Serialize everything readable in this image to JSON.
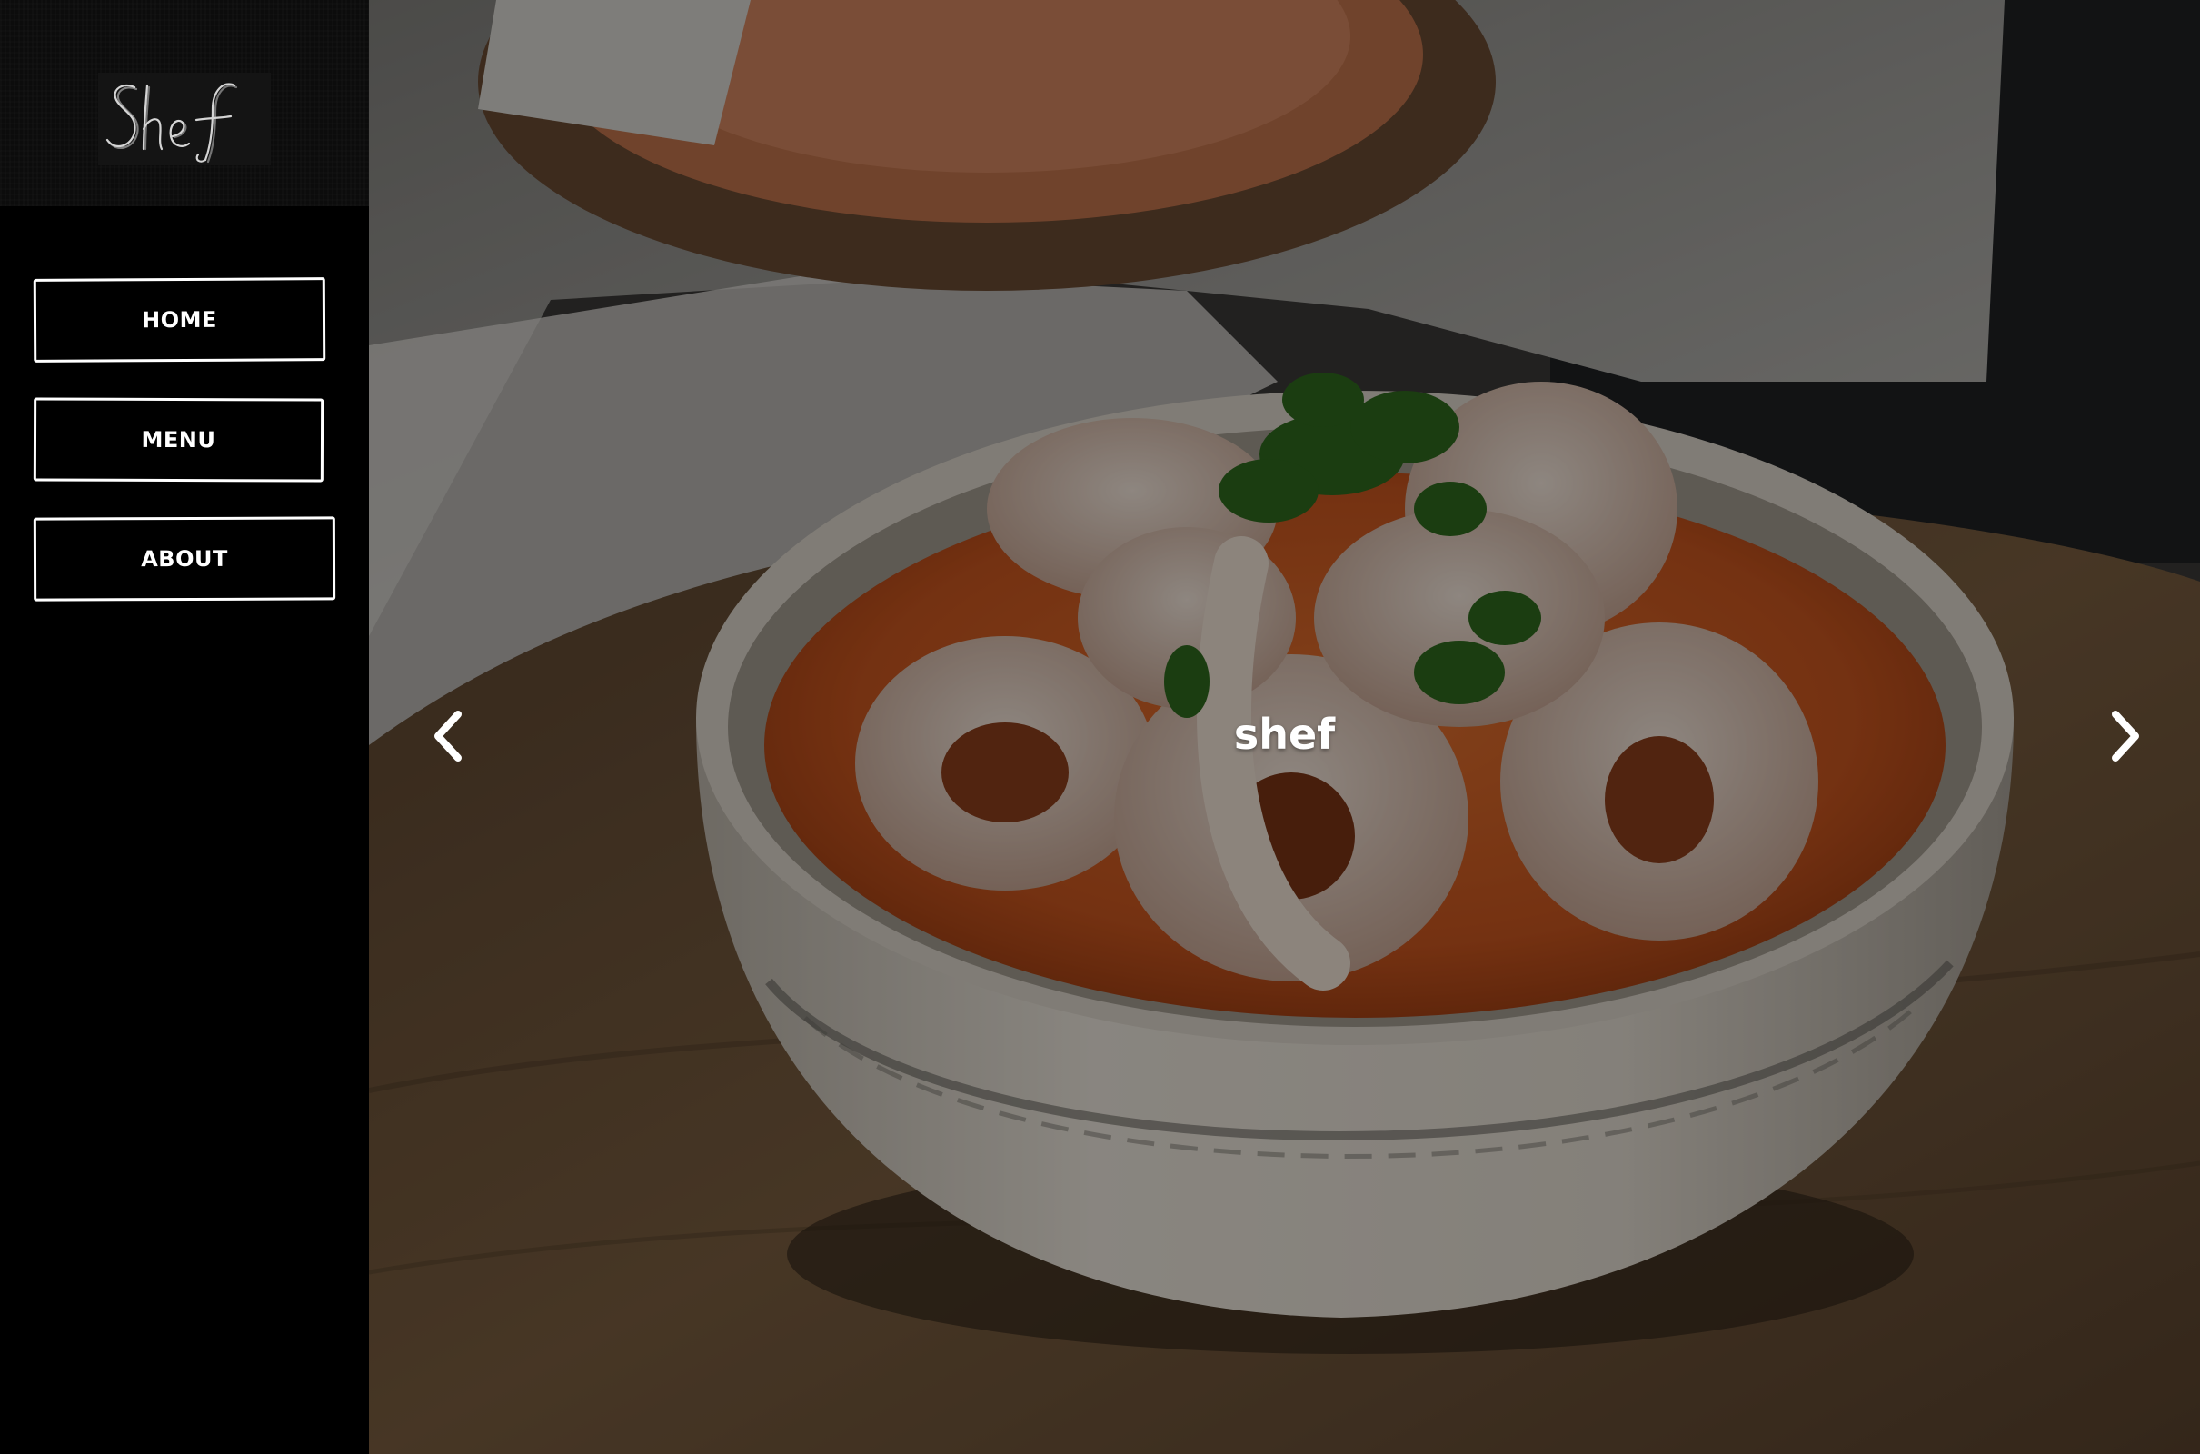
{
  "sidebar": {
    "logo_text": "Shef",
    "nav": [
      {
        "label": "HOME"
      },
      {
        "label": "MENU"
      },
      {
        "label": "ABOUT"
      }
    ]
  },
  "hero": {
    "title": "shef",
    "prev_icon": "chevron-left-icon",
    "next_icon": "chevron-right-icon",
    "image_subject": "bowl of calamari rings in orange sauce with parsley garnish"
  },
  "colors": {
    "sidebar_bg": "#000000",
    "text": "#ffffff",
    "sauce": "#d0612a",
    "bowl": "#e7e1d8",
    "wood": "#6a5238"
  }
}
